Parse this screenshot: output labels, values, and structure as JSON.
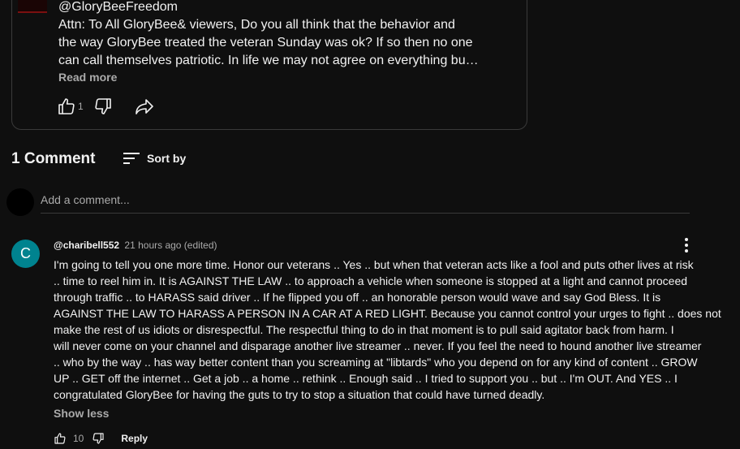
{
  "post": {
    "author": "@GloryBeeFreedom",
    "lines": [
      "Attn: To All  GloryBee& viewers, Do you all think that the behavior and",
      "the way GloryBee treated the veteran Sunday was ok? If so then no one",
      "can call themselves patriotic. In life we may not agree on everything bu…"
    ],
    "read_more": "Read more",
    "like_count": "1",
    "icons": {
      "like": "thumbs-up-icon",
      "dislike": "thumbs-down-icon",
      "share": "share-icon"
    }
  },
  "comments_section": {
    "count_label": "1 Comment",
    "sort_label": "Sort by",
    "add_comment_placeholder": "Add a comment..."
  },
  "comment": {
    "avatar_letter": "C",
    "avatar_color": "#00838f",
    "author": "@charibell552",
    "time": "21 hours ago (edited)",
    "lines": [
      "I'm going to tell you one more time.  Honor our veterans .. Yes ..  but when that veteran acts like a fool and puts other lives at risk",
      ".. time to reel him in.  It is AGAINST THE LAW .. to approach a vehicle when someone is stopped at a light and cannot proceed",
      "through traffic .. to HARASS said driver .. If he flipped you off .. an honorable person would wave and say God Bless.  It is",
      "AGAINST THE LAW TO HARASS A PERSON IN A CAR AT A RED LIGHT.  Because you cannot control your urges to fight .. does not",
      "make the rest of us idiots or disrespectful.  The respectful thing to do in that moment is to pull said agitator back from harm.  I",
      "will never come on your channel and disparage another live streamer ..  never.  If you feel the need to hound another live streamer",
      ".. who by the way .. has way better content than you screaming at \"libtards\" who you depend on for any kind of content ..  GROW",
      "UP .. GET off the internet .. Get a job .. a home .. rethink ..  Enough said  .. I tried to support you .. but .. I'm OUT.  And YES .. I",
      "congratulated GloryBee for having the guts to try to stop a situation that could have turned deadly."
    ],
    "show_less": "Show less",
    "like_count": "10",
    "reply_label": "Reply"
  }
}
